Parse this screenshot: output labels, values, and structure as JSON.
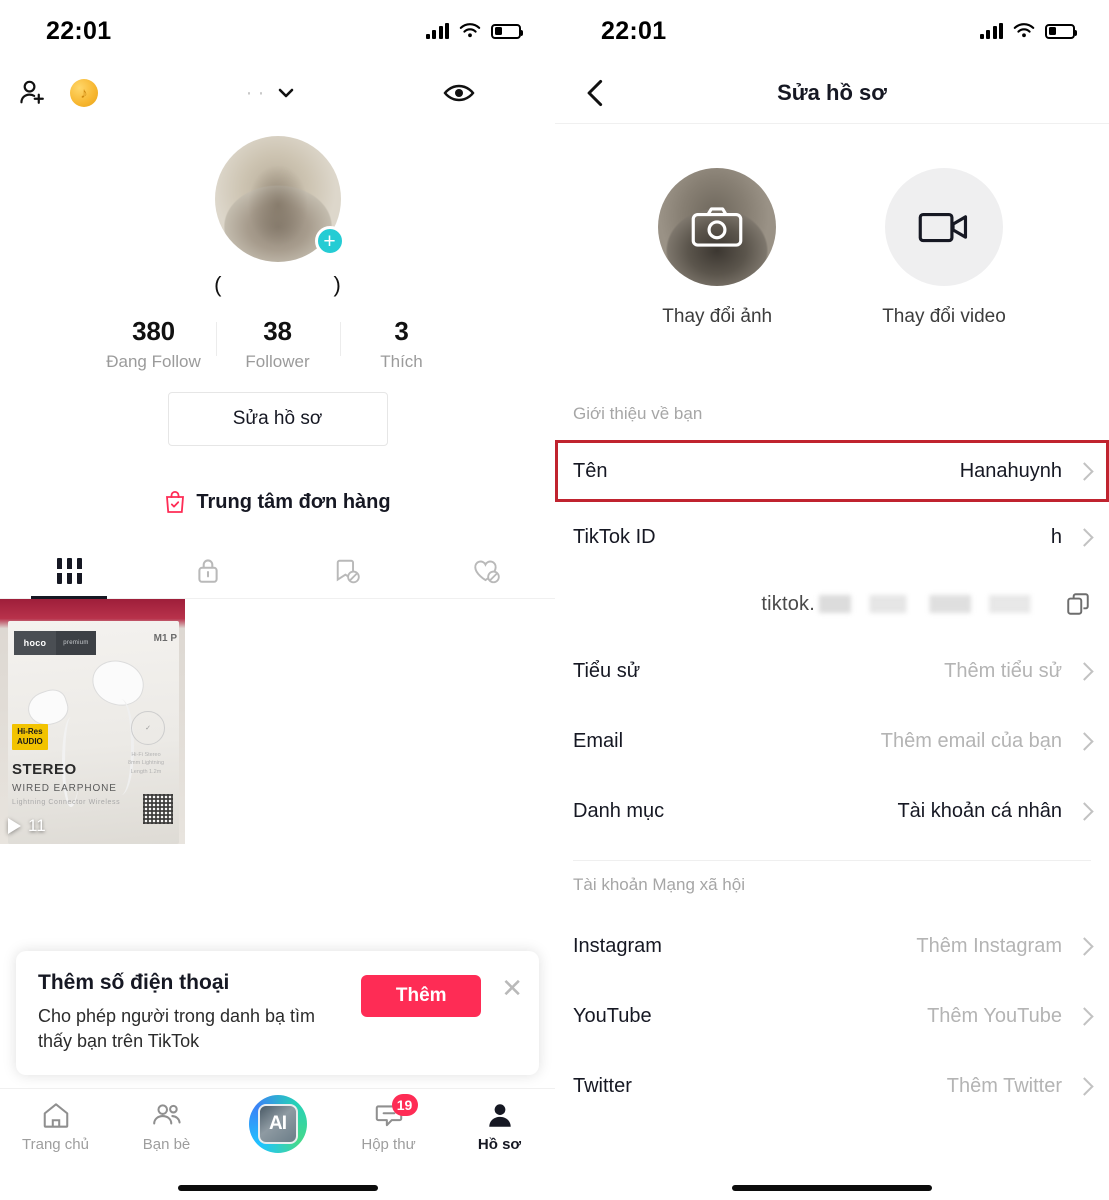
{
  "status_bar": {
    "time": "22:01"
  },
  "left_panel": {
    "topbar": {
      "add_person_icon": "add-person-icon",
      "coin_icon": "tiktok-coin-icon",
      "username_masked": "··",
      "chevron_icon": "chevron-down-icon",
      "eye_icon": "eye-icon",
      "menu_icon": "hamburger-menu-icon"
    },
    "avatar": {
      "plus_label": "+"
    },
    "handle": {
      "left_paren": "(",
      "right_paren": ")"
    },
    "stats": [
      {
        "value": "380",
        "label": "Đang Follow"
      },
      {
        "value": "38",
        "label": "Follower"
      },
      {
        "value": "3",
        "label": "Thích"
      }
    ],
    "edit_profile_button": "Sửa hồ sơ",
    "order_center": "Trung tâm đơn hàng",
    "tabs": [
      {
        "name": "grid",
        "icon": "grid-icon",
        "active": true
      },
      {
        "name": "private",
        "icon": "lock-icon",
        "active": false
      },
      {
        "name": "saved",
        "icon": "bookmark-off-icon",
        "active": false
      },
      {
        "name": "liked",
        "icon": "heart-off-icon",
        "active": false
      }
    ],
    "video": {
      "brand": "hoco",
      "brand_sub": "premium",
      "model": "M1 P",
      "hires_line1": "Hi-Res",
      "hires_line2": "AUDIO",
      "stereo": "STEREO",
      "wired": "WIRED EARPHONE",
      "lightning": "Lightning Connector Wireless",
      "play_count": "11"
    },
    "banner": {
      "title": "Thêm số điện thoại",
      "subtitle": "Cho phép người trong danh bạ tìm thấy bạn trên TikTok",
      "button": "Thêm",
      "close_icon": "close-icon"
    },
    "bottom_nav": [
      {
        "label": "Trang chủ",
        "icon": "home-icon",
        "active": false
      },
      {
        "label": "Bạn bè",
        "icon": "friends-icon",
        "active": false
      },
      {
        "label": "",
        "icon": "ai-create-icon",
        "active": false,
        "center": true
      },
      {
        "label": "Hộp thư",
        "icon": "inbox-icon",
        "active": false,
        "badge": "19"
      },
      {
        "label": "Hồ sơ",
        "icon": "profile-icon",
        "active": true
      }
    ]
  },
  "right_panel": {
    "header": {
      "title": "Sửa hồ sơ",
      "back_icon": "back-chevron-icon"
    },
    "media": [
      {
        "label": "Thay đổi ảnh",
        "icon": "camera-icon"
      },
      {
        "label": "Thay đổi video",
        "icon": "video-camera-icon"
      }
    ],
    "section_about": "Giới thiệu về bạn",
    "rows_about": [
      {
        "label": "Tên",
        "value": "Hanahuynh",
        "placeholder": false,
        "highlight": true
      },
      {
        "label": "TikTok ID",
        "value": "h",
        "placeholder": false,
        "highlight": false
      }
    ],
    "url_row": {
      "prefix": "tiktok.",
      "copy_icon": "copy-icon"
    },
    "rows_more": [
      {
        "label": "Tiểu sử",
        "value": "Thêm tiểu sử",
        "placeholder": true
      },
      {
        "label": "Email",
        "value": "Thêm email của bạn",
        "placeholder": true
      },
      {
        "label": "Danh mục",
        "value": "Tài khoản cá nhân",
        "placeholder": false
      }
    ],
    "section_social": "Tài khoản Mạng xã hội",
    "rows_social": [
      {
        "label": "Instagram",
        "value": "Thêm Instagram",
        "placeholder": true
      },
      {
        "label": "YouTube",
        "value": "Thêm YouTube",
        "placeholder": true
      },
      {
        "label": "Twitter",
        "value": "Thêm Twitter",
        "placeholder": true
      }
    ]
  },
  "colors": {
    "accent_red": "#fe2c55",
    "highlight_border": "#c0232f",
    "cyan_badge": "#25ccd4"
  }
}
